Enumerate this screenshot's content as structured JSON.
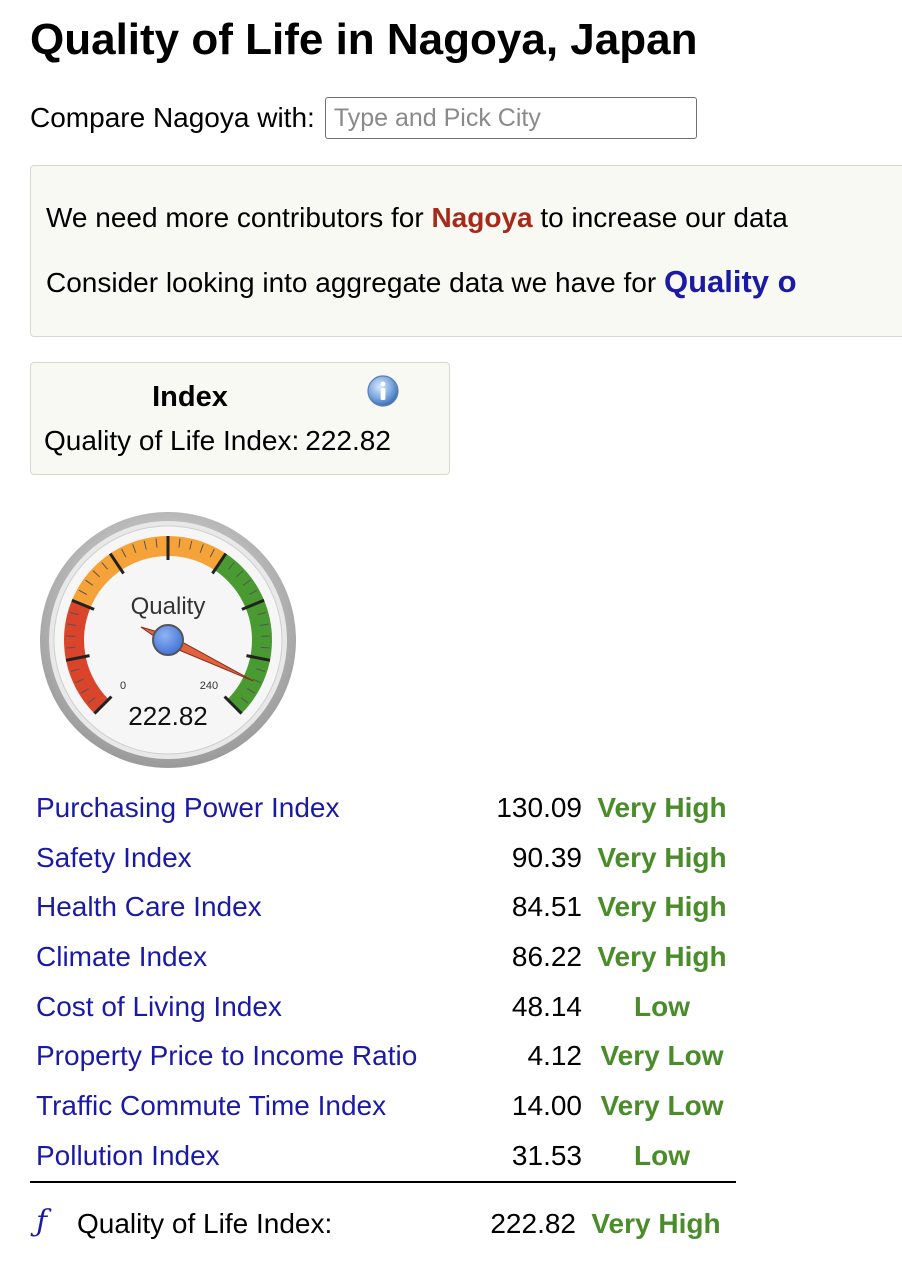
{
  "page": {
    "title": "Quality of Life in Nagoya, Japan"
  },
  "compare": {
    "label": "Compare Nagoya with:",
    "placeholder": "Type and Pick City"
  },
  "notice": {
    "line1_prefix": "We need more contributors for ",
    "line1_city": "Nagoya",
    "line1_suffix": " to increase our data",
    "line2_prefix": "Consider looking into aggregate data we have for ",
    "line2_link": "Quality o"
  },
  "index_box": {
    "title": "Index",
    "label": "Quality of Life Index:",
    "value": "222.82",
    "info_icon": "info-icon"
  },
  "gauge": {
    "label": "Quality",
    "min": 0,
    "max": 240,
    "min_label": "0",
    "max_label": "240",
    "value": 222.82,
    "value_label": "222.82",
    "colors": {
      "low": "#d9442b",
      "mid": "#f5a238",
      "high": "#4a9a32",
      "needle": "#e0623e",
      "hub": "#5b8de8"
    }
  },
  "metrics": [
    {
      "name": "Purchasing Power Index",
      "value": "130.09",
      "rating": "Very High"
    },
    {
      "name": "Safety Index",
      "value": "90.39",
      "rating": "Very High"
    },
    {
      "name": "Health Care Index",
      "value": "84.51",
      "rating": "Very High"
    },
    {
      "name": "Climate Index",
      "value": "86.22",
      "rating": "Very High"
    },
    {
      "name": "Cost of Living Index",
      "value": "48.14",
      "rating": "Low"
    },
    {
      "name": "Property Price to Income Ratio",
      "value": "4.12",
      "rating": "Very Low"
    },
    {
      "name": "Traffic Commute Time Index",
      "value": "14.00",
      "rating": "Very Low"
    },
    {
      "name": "Pollution Index",
      "value": "31.53",
      "rating": "Low"
    }
  ],
  "total": {
    "symbol": "ƒ",
    "label": "Quality of Life Index:",
    "value": "222.82",
    "rating": "Very High"
  },
  "colors": {
    "link": "#1a1aa6",
    "rating_green": "#4a8c2a",
    "city_red": "#a52a1a"
  }
}
